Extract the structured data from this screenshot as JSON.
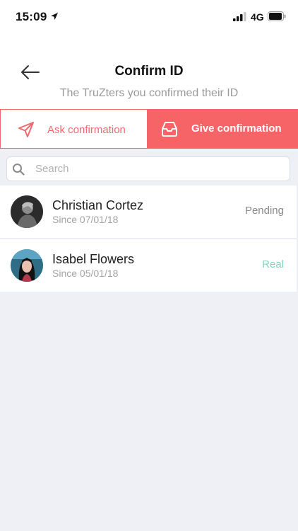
{
  "status_bar": {
    "time": "15:09",
    "network": "4G"
  },
  "header": {
    "title": "Confirm ID",
    "subtitle": "The TruZters you confirmed their ID",
    "back_icon": "arrow-left-icon"
  },
  "tabs": [
    {
      "label": "Ask confirmation",
      "icon": "send-icon",
      "active": false
    },
    {
      "label": "Give confirmation",
      "icon": "inbox-icon",
      "active": true
    }
  ],
  "search": {
    "placeholder": "Search",
    "value": ""
  },
  "people": [
    {
      "name": "Christian Cortez",
      "since": "Since 07/01/18",
      "status": "Pending"
    },
    {
      "name": "Isabel Flowers",
      "since": "Since 05/01/18",
      "status": "Real"
    }
  ],
  "colors": {
    "accent": "#f66468",
    "status_pending": "#8a8a8e",
    "status_real": "#7fd7bd",
    "background": "#eff0f5"
  }
}
